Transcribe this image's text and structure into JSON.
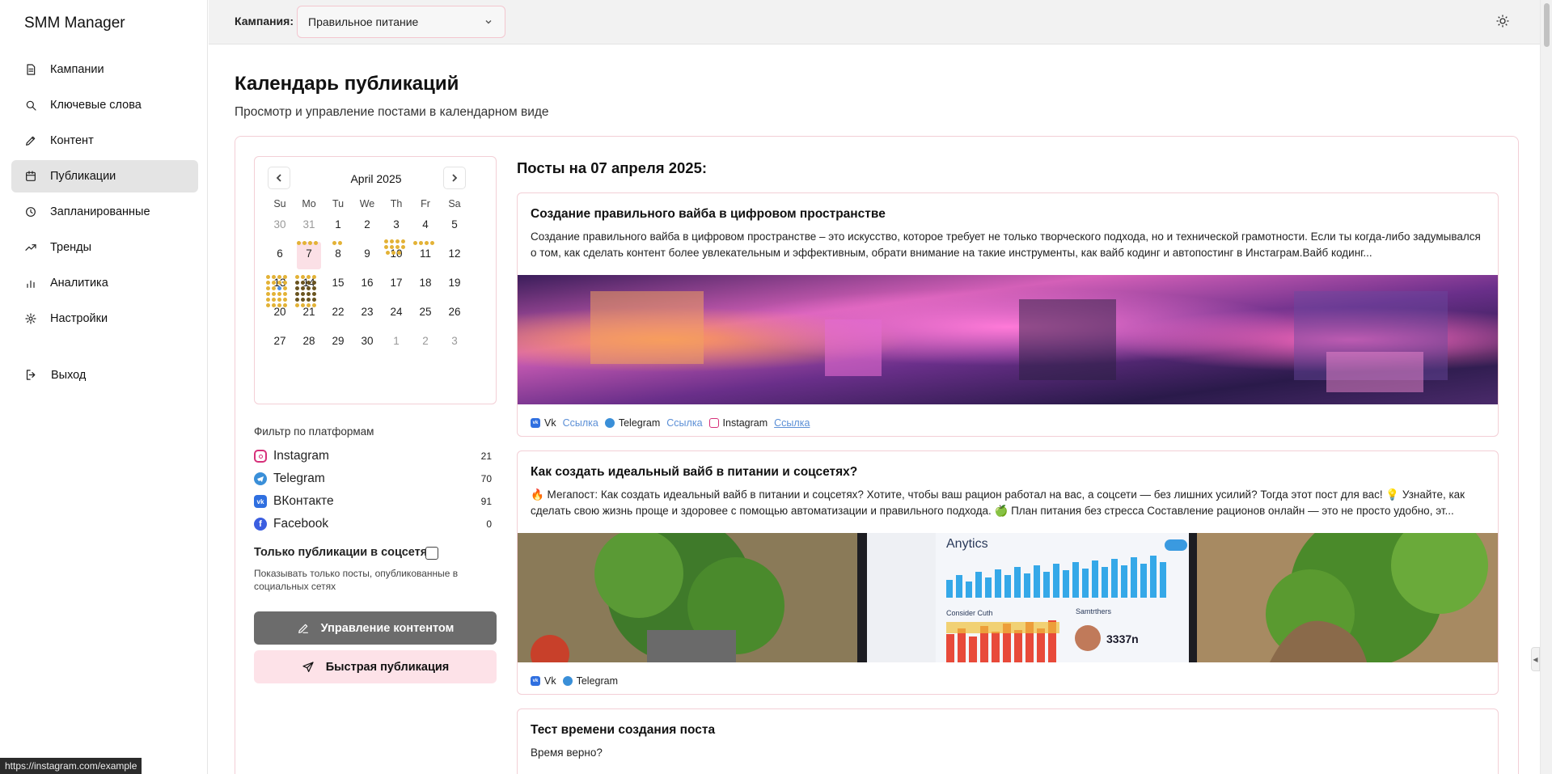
{
  "app": {
    "title": "SMM Manager"
  },
  "nav": {
    "items": [
      {
        "label": "Кампании",
        "icon": "file-icon"
      },
      {
        "label": "Ключевые слова",
        "icon": "search-icon"
      },
      {
        "label": "Контент",
        "icon": "pen-icon"
      },
      {
        "label": "Публикации",
        "icon": "calendar-icon",
        "active": true
      },
      {
        "label": "Запланированные",
        "icon": "clock-icon"
      },
      {
        "label": "Тренды",
        "icon": "trending-icon"
      },
      {
        "label": "Аналитика",
        "icon": "bar-chart-icon"
      },
      {
        "label": "Настройки",
        "icon": "gear-icon"
      }
    ],
    "logout": "Выход"
  },
  "topbar": {
    "campaign_label": "Кампания:",
    "campaign_value": "Правильное питание"
  },
  "page": {
    "title": "Календарь публикаций",
    "subtitle": "Просмотр и управление постами в календарном виде"
  },
  "calendar": {
    "month": "April 2025",
    "weekdays": [
      "Su",
      "Mo",
      "Tu",
      "We",
      "Th",
      "Fr",
      "Sa"
    ],
    "weeks": [
      [
        "30",
        "31",
        "1",
        "2",
        "3",
        "4",
        "5"
      ],
      [
        "6",
        "7",
        "8",
        "9",
        "10",
        "11",
        "12"
      ],
      [
        "13",
        "14",
        "15",
        "16",
        "17",
        "18",
        "19"
      ],
      [
        "20",
        "21",
        "22",
        "23",
        "24",
        "25",
        "26"
      ],
      [
        "27",
        "28",
        "29",
        "30",
        "1",
        "2",
        "3"
      ]
    ],
    "selected": "7"
  },
  "filter": {
    "title": "Фильтр по платформам",
    "platforms": [
      {
        "name": "Instagram",
        "count": "21",
        "color": "#d6307a"
      },
      {
        "name": "Telegram",
        "count": "70",
        "color": "#3a8fd8"
      },
      {
        "name": "ВКонтакте",
        "count": "91",
        "color": "#2f6fe0"
      },
      {
        "name": "Facebook",
        "count": "0",
        "color": "#3b5ee0"
      }
    ],
    "only_published_label": "Только публикации в соцсетях",
    "only_published_hint": "Показывать только посты, опубликованные в социальных сетях"
  },
  "actions": {
    "manage": "Управление контентом",
    "quick": "Быстрая публикация"
  },
  "posts": {
    "heading": "Посты на 07 апреля 2025:",
    "items": [
      {
        "title": "Создание правильного вайба в цифровом пространстве",
        "text": "Создание правильного вайба в цифровом пространстве – это искусство, которое требует не только творческого подхода, но и технической грамотности. Если ты когда-либо задумывался о том, как сделать контент более увлекательным и эффективным, обрати внимание на такие инструменты, как вайб кодинг и автопостинг в Инстаграм.Вайб кодинг...",
        "networks": [
          "Vk",
          "Telegram",
          "Instagram"
        ],
        "link_label": "Ссылка"
      },
      {
        "title": "Как создать идеальный вайб в питании и соцсетях?",
        "text": "🔥 Мегапост: Как создать идеальный вайб в питании и соцсетях? Хотите, чтобы ваш рацион работал на вас, а соцсети — без лишних усилий? Тогда этот пост для вас! 💡 Узнайте, как сделать свою жизнь проще и здоровее с помощью автоматизации и правильного подхода. 🍏 План питания без стресса Составление рационов онлайн — это не просто удобно, эт...",
        "networks": [
          "Vk",
          "Telegram"
        ],
        "image_text": {
          "title": "Anytics",
          "label": "Consider Cuth",
          "side": "Samtrthers",
          "value": "3337n"
        }
      },
      {
        "title": "Тест времени создания поста",
        "text": "Время верно?"
      }
    ]
  },
  "status_url": "https://instagram.com/example"
}
